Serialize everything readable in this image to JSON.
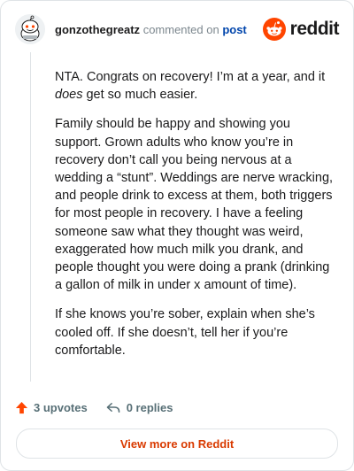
{
  "header": {
    "username": "gonzothegreatz",
    "action_text": "commented on",
    "post_link": "post",
    "brand_wordmark": "reddit",
    "brand_color": "#ff4500"
  },
  "comment": {
    "p1_before": "NTA. Congrats on recovery! I’m at a year, and it",
    "p1_emph": "does",
    "p1_after": "get so much easier.",
    "p2": "Family should be happy and showing you support. Grown adults who know you’re in recovery don’t call you being nervous at a wedding a “stunt”. Weddings are nerve wracking, and people drink to excess at them, both triggers for most people in recovery. I have a feeling someone saw what they thought was weird, exaggerated how much milk you drank, and people thought you were doing a prank (drinking a gallon of milk in under x amount of time).",
    "p3": "If she knows you’re sober, explain when she’s cooled off. If she doesn’t, tell her if you’re comfortable."
  },
  "actions": {
    "upvotes": "3 upvotes",
    "replies": "0 replies",
    "upvote_icon": "upvote-arrow-icon",
    "reply_icon": "reply-arrow-icon",
    "upvote_color": "#ff4500"
  },
  "footer": {
    "view_more": "View more on Reddit",
    "link_color": "#d93a00"
  }
}
